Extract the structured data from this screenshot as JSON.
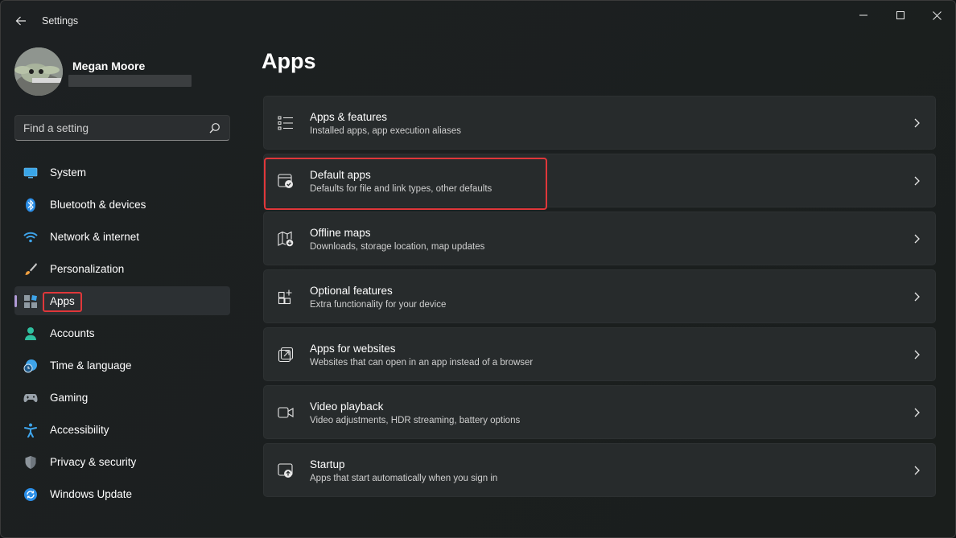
{
  "window": {
    "title": "Settings"
  },
  "profile": {
    "name": "Megan Moore"
  },
  "search": {
    "placeholder": "Find a setting"
  },
  "nav": {
    "items": [
      {
        "label": "System",
        "icon": "monitor-icon"
      },
      {
        "label": "Bluetooth & devices",
        "icon": "bluetooth-icon"
      },
      {
        "label": "Network & internet",
        "icon": "wifi-icon"
      },
      {
        "label": "Personalization",
        "icon": "brush-icon"
      },
      {
        "label": "Apps",
        "icon": "apps-icon",
        "selected": true
      },
      {
        "label": "Accounts",
        "icon": "person-icon"
      },
      {
        "label": "Time & language",
        "icon": "clock-globe-icon"
      },
      {
        "label": "Gaming",
        "icon": "gamepad-icon"
      },
      {
        "label": "Accessibility",
        "icon": "accessibility-icon"
      },
      {
        "label": "Privacy & security",
        "icon": "shield-icon"
      },
      {
        "label": "Windows Update",
        "icon": "update-icon"
      }
    ]
  },
  "main": {
    "title": "Apps",
    "cards": [
      {
        "title": "Apps & features",
        "subtitle": "Installed apps, app execution aliases",
        "icon": "list-icon"
      },
      {
        "title": "Default apps",
        "subtitle": "Defaults for file and link types, other defaults",
        "icon": "default-apps-icon"
      },
      {
        "title": "Offline maps",
        "subtitle": "Downloads, storage location, map updates",
        "icon": "map-icon"
      },
      {
        "title": "Optional features",
        "subtitle": "Extra functionality for your device",
        "icon": "grid-plus-icon"
      },
      {
        "title": "Apps for websites",
        "subtitle": "Websites that can open in an app instead of a browser",
        "icon": "open-external-icon"
      },
      {
        "title": "Video playback",
        "subtitle": "Video adjustments, HDR streaming, battery options",
        "icon": "video-icon"
      },
      {
        "title": "Startup",
        "subtitle": "Apps that start automatically when you sign in",
        "icon": "startup-icon"
      }
    ]
  },
  "colors": {
    "highlight": "#e0373a",
    "accent": "#b09ad6",
    "card": "#272b2c"
  }
}
